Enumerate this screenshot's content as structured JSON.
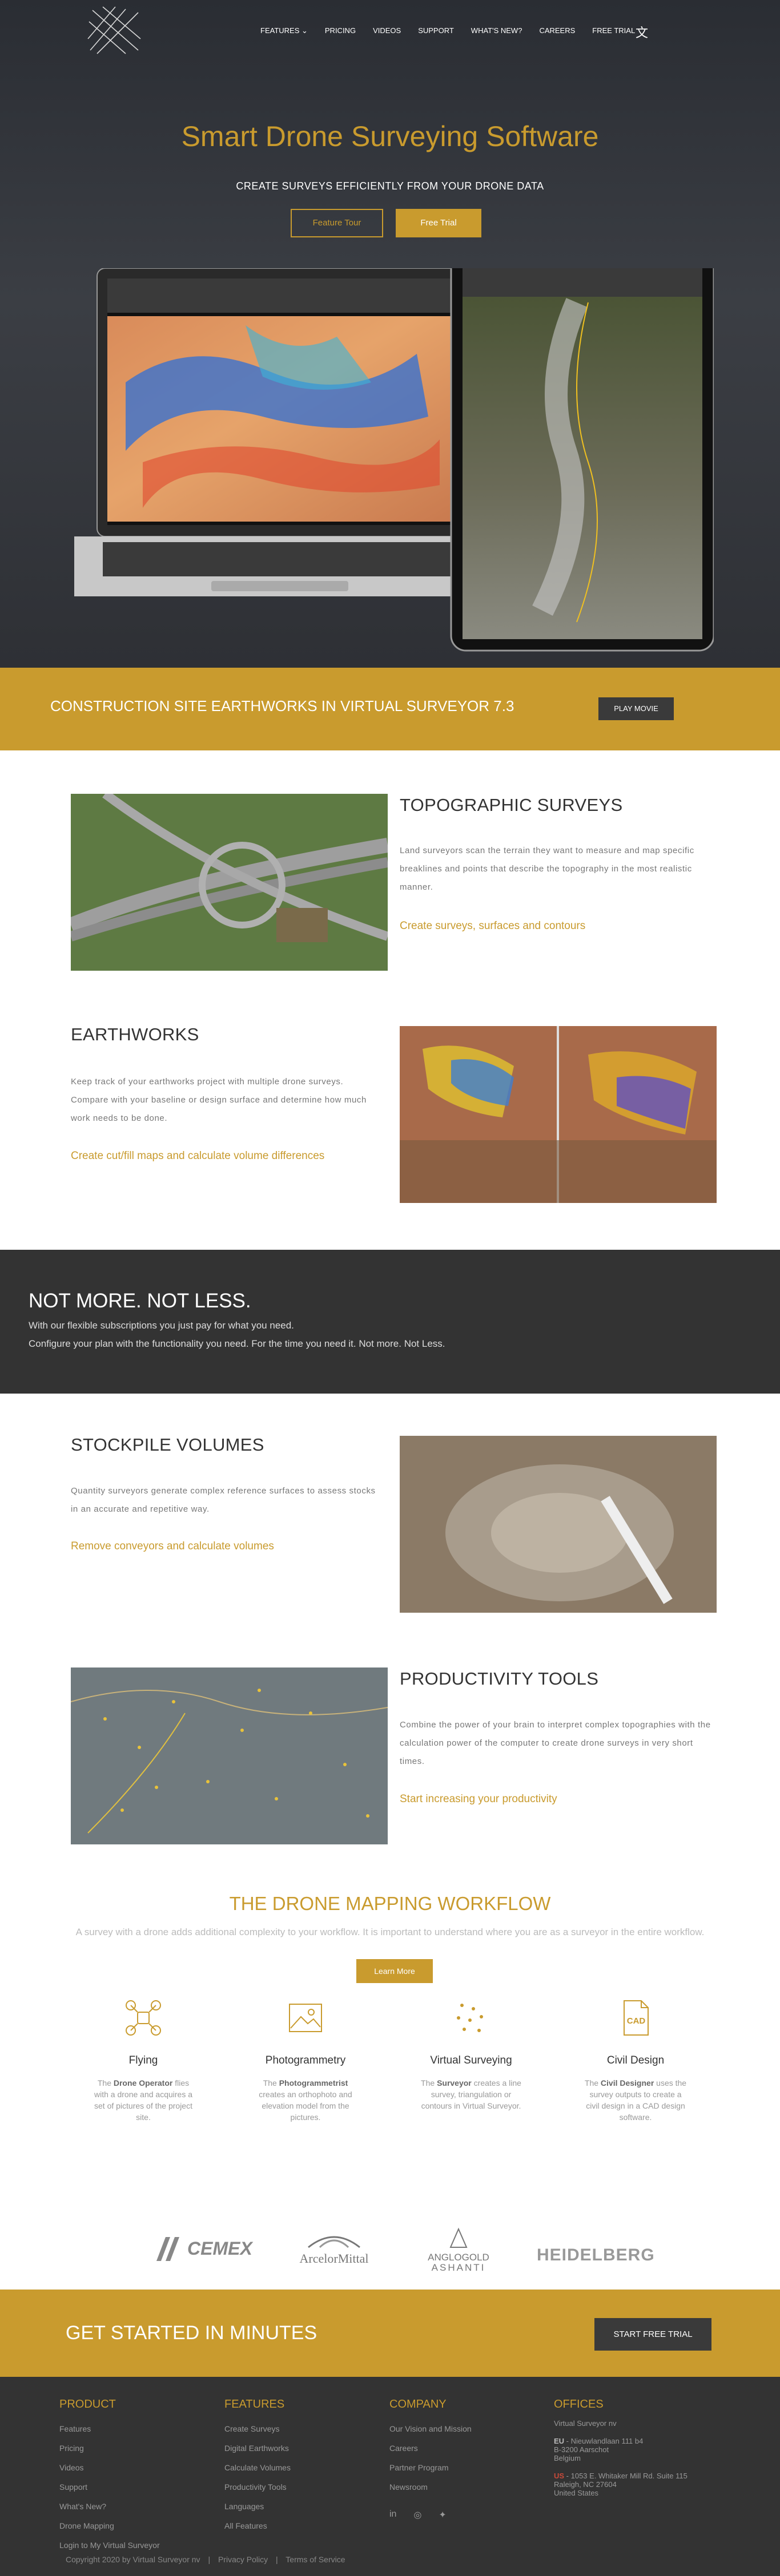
{
  "nav": {
    "items": [
      "FEATURES ⌄",
      "PRICING",
      "VIDEOS",
      "SUPPORT",
      "WHAT'S NEW?",
      "CAREERS",
      "FREE TRIAL"
    ]
  },
  "hero": {
    "title": "Smart Drone Surveying Software",
    "subtitle": "CREATE SURVEYS EFFICIENTLY FROM YOUR DRONE DATA",
    "btn_tour": "Feature Tour",
    "btn_trial": "Free Trial"
  },
  "movie": {
    "title": "CONSTRUCTION SITE EARTHWORKS IN VIRTUAL SURVEYOR 7.3",
    "button": "PLAY MOVIE"
  },
  "features": [
    {
      "title": "TOPOGRAPHIC SURVEYS",
      "text": "Land surveyors scan the terrain they want to measure and map specific breaklines and points that describe the topography in the most realistic manner.",
      "link": "Create surveys, surfaces and contours"
    },
    {
      "title": "EARTHWORKS",
      "text": "Keep track of your earthworks project with multiple drone surveys. Compare with your baseline or design surface and determine how much work needs to be done.",
      "link": "Create cut/fill maps and calculate volume differences"
    },
    {
      "title": "STOCKPILE VOLUMES",
      "text": "Quantity surveyors generate complex reference surfaces to assess stocks in an accurate and repetitive way.",
      "link": "Remove conveyors and calculate volumes"
    },
    {
      "title": "PRODUCTIVITY TOOLS",
      "text": "Combine the power of your brain to interpret complex topographies with the calculation power of the computer to create drone surveys in very short times.",
      "link": "Start increasing your productivity"
    }
  ],
  "notmore": {
    "title": "NOT MORE. NOT LESS.",
    "line1": "With our flexible subscriptions you just pay for what you need.",
    "line2": "Configure your plan with the functionality you need. For the time you need it. Not more. Not Less."
  },
  "workflow": {
    "title": "THE DRONE MAPPING WORKFLOW",
    "subtitle": "A survey with a drone adds additional complexity to your workflow. It is important to understand where you are as a surveyor in the entire workflow.",
    "button": "Learn More",
    "steps": [
      {
        "title": "Flying",
        "pre": "The ",
        "bold": "Drone Operator",
        "post": " flies with a drone and acquires a set of pictures of the project site.",
        "icon": "drone-icon"
      },
      {
        "title": "Photogrammetry",
        "pre": "The ",
        "bold": "Photogrammetrist",
        "post": " creates an orthophoto and elevation model from the pictures.",
        "icon": "image-icon"
      },
      {
        "title": "Virtual Surveying",
        "pre": "The ",
        "bold": "Surveyor",
        "post": " creates a line survey, triangulation or contours in Virtual Surveyor.",
        "icon": "points-icon"
      },
      {
        "title": "Civil Design",
        "pre": "The ",
        "bold": "Civil Designer",
        "post": " uses the survey outputs to create a civil design in a CAD design software.",
        "icon": "cad-file-icon"
      }
    ]
  },
  "logos": [
    "CEMEX",
    "ArcelorMittal",
    "ANGLOGOLD",
    "ASHANTI",
    "HEIDELBERG"
  ],
  "get_started": {
    "title": "GET STARTED IN MINUTES",
    "button": "START FREE TRIAL"
  },
  "footer": {
    "product": {
      "title": "PRODUCT",
      "items": [
        "Features",
        "Pricing",
        "Videos",
        "Support",
        "What's New?",
        "Drone Mapping",
        "Login to My Virtual Surveyor"
      ]
    },
    "features": {
      "title": "FEATURES",
      "items": [
        "Create Surveys",
        "Digital Earthworks",
        "Calculate Volumes",
        "Productivity Tools",
        "Languages",
        "All Features"
      ]
    },
    "company": {
      "title": "COMPANY",
      "items": [
        "Our Vision and Mission",
        "Careers",
        "Partner Program",
        "Newsroom"
      ]
    },
    "offices": {
      "title": "OFFICES",
      "name": "Virtual Surveyor nv",
      "eu_label": "EU",
      "eu_line1": " - Nieuwlandlaan 111 b4",
      "eu_line2": "B-3200 Aarschot",
      "eu_line3": "Belgium",
      "us_label": "US",
      "us_line1": " - 1053 E. Whitaker Mill Rd. Suite 115",
      "us_line2": "Raleigh, NC 27604",
      "us_line3": "United States"
    },
    "copyright": "Copyright 2020 by Virtual Surveyor nv",
    "privacy": "Privacy Policy",
    "terms": "Terms of Service"
  },
  "colors": {
    "accent": "#c99b2e",
    "dark": "#333333"
  }
}
